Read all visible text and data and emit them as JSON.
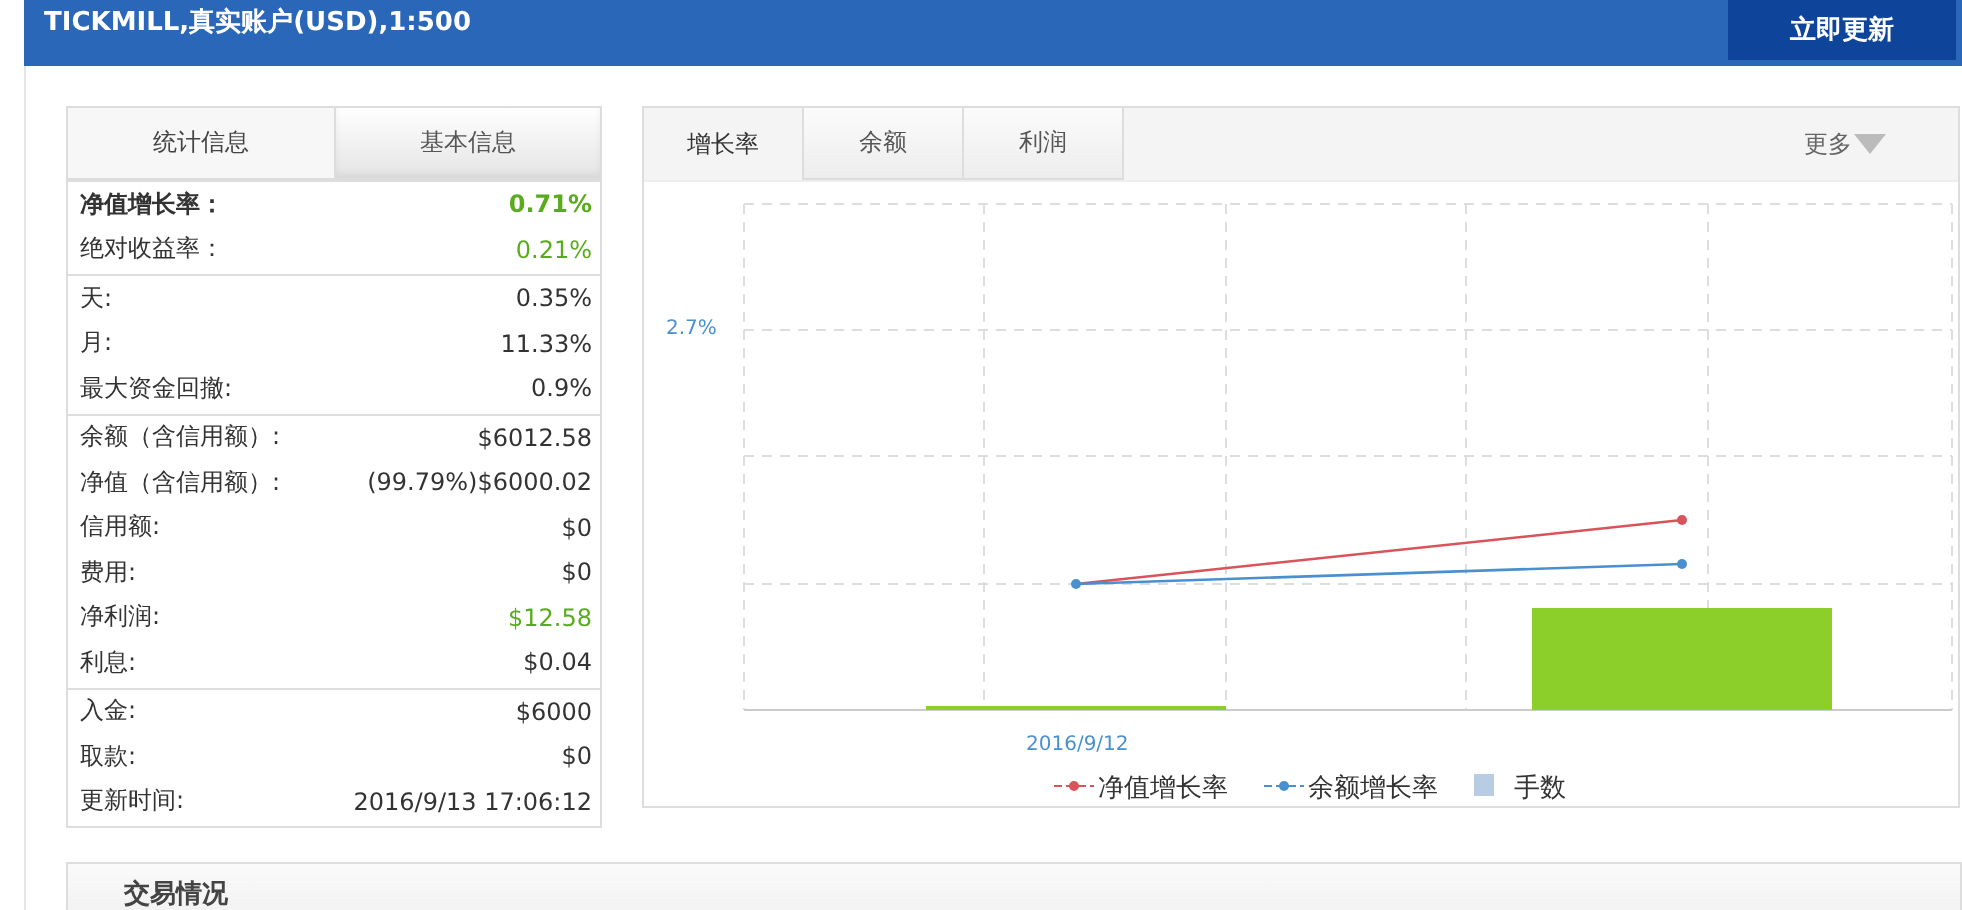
{
  "header": {
    "title": "TICKMILL,真实账户(USD),1:500",
    "button": "立即更新"
  },
  "stats_tabs": [
    {
      "label": "统计信息",
      "selected": true
    },
    {
      "label": "基本信息",
      "selected": false
    }
  ],
  "stats_groups": [
    {
      "rows": [
        {
          "label": "净值增长率：",
          "value": "0.71%",
          "bold": true,
          "positive": true
        },
        {
          "label": "绝对收益率：",
          "value": "0.21%",
          "bold": false,
          "positive": true
        }
      ]
    },
    {
      "rows": [
        {
          "label": "天:",
          "value": "0.35%",
          "bold": false,
          "positive": false
        },
        {
          "label": "月:",
          "value": "11.33%",
          "bold": false,
          "positive": false
        },
        {
          "label": "最大资金回撤:",
          "value": "0.9%",
          "bold": false,
          "positive": false
        }
      ]
    },
    {
      "rows": [
        {
          "label": "余额（含信用额）:",
          "value": "$6012.58",
          "bold": false,
          "positive": false
        },
        {
          "label": "净值（含信用额）:",
          "value": "(99.79%)$6000.02",
          "bold": false,
          "positive": false
        },
        {
          "label": "信用额:",
          "value": "$0",
          "bold": false,
          "positive": false
        },
        {
          "label": "费用:",
          "value": "$0",
          "bold": false,
          "positive": false
        },
        {
          "label": "净利润:",
          "value": "$12.58",
          "bold": false,
          "positive": true
        },
        {
          "label": "利息:",
          "value": "$0.04",
          "bold": false,
          "positive": false
        }
      ]
    },
    {
      "rows": [
        {
          "label": "入金:",
          "value": "$6000",
          "bold": false,
          "positive": false
        },
        {
          "label": "取款:",
          "value": "$0",
          "bold": false,
          "positive": false
        },
        {
          "label": "更新时间:",
          "value": "2016/9/13 17:06:12",
          "bold": false,
          "positive": false
        }
      ]
    }
  ],
  "chart_tabs": [
    {
      "label": "增长率",
      "selected": true
    },
    {
      "label": "余额",
      "selected": false
    },
    {
      "label": "利润",
      "selected": false
    }
  ],
  "more_menu": "更多",
  "chart": {
    "y_label": "2.7%",
    "x_label": "2016/9/12",
    "legend": [
      {
        "label": "净值增长率",
        "kind": "line",
        "color": "#d9535b"
      },
      {
        "label": "余额增长率",
        "kind": "line",
        "color": "#4a90d0"
      },
      {
        "label": "手数",
        "kind": "bar",
        "color": "#b8cce4"
      }
    ]
  },
  "trades_panel": {
    "title": "交易情况"
  }
}
